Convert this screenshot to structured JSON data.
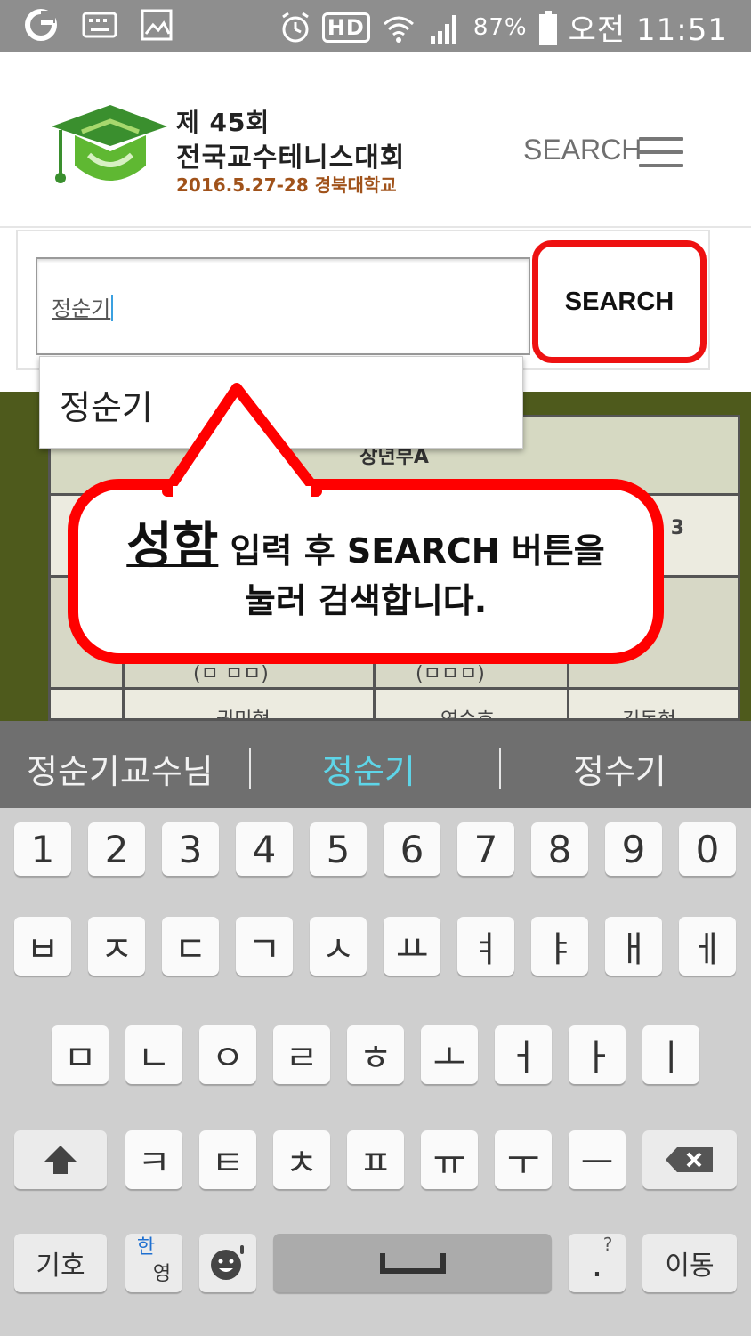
{
  "status_bar": {
    "battery_percent": "87%",
    "time": "오전 11:51",
    "network_label": "HD"
  },
  "header": {
    "logo_line1": "제 45회",
    "logo_line2": "전국교수테니스대회",
    "logo_date": "2016.5.27-28 경북대학교",
    "search_link": "SEARCH"
  },
  "search": {
    "input_value": "정순기",
    "button_label": "SEARCH"
  },
  "autocomplete": {
    "items": [
      "정순기"
    ]
  },
  "table": {
    "header": "장년부A",
    "row2_col3": "3",
    "row3_col1": "(ㅁ ㅁㅁ)",
    "row3_col2": "(ㅁㅁㅁ)",
    "row4": [
      "권민혁",
      "염승호",
      "김동현"
    ]
  },
  "callout": {
    "big_word": "성함",
    "line1_rest": " 입력 후 SEARCH 버튼을",
    "line2": "눌러 검색합니다."
  },
  "keyboard": {
    "suggestions": [
      "정순기교수님",
      "정순기",
      "정수기"
    ],
    "active_suggestion_index": 1,
    "row_numbers": [
      "1",
      "2",
      "3",
      "4",
      "5",
      "6",
      "7",
      "8",
      "9",
      "0"
    ],
    "row1": [
      "ㅂ",
      "ㅈ",
      "ㄷ",
      "ㄱ",
      "ㅅ",
      "ㅛ",
      "ㅕ",
      "ㅑ",
      "ㅐ",
      "ㅔ"
    ],
    "row2": [
      "ㅁ",
      "ㄴ",
      "ㅇ",
      "ㄹ",
      "ㅎ",
      "ㅗ",
      "ㅓ",
      "ㅏ",
      "ㅣ"
    ],
    "row3": [
      "ㅋ",
      "ㅌ",
      "ㅊ",
      "ㅍ",
      "ㅠ",
      "ㅜ",
      "ㅡ"
    ],
    "symbols_label": "기호",
    "lang_label_top": "한",
    "lang_label_bottom": "영",
    "move_label": "이동",
    "punct_label": "?",
    "punct_main": "."
  },
  "colors": {
    "highlight_red": "#ee1111",
    "suggestion_active": "#5ed5e8",
    "page_olive": "#4e5a1c"
  },
  "icons": [
    "sync-icon",
    "keyboard-icon",
    "image-icon",
    "alarm-icon",
    "wifi-icon",
    "signal-icon",
    "battery-icon",
    "hamburger-menu-icon",
    "shift-icon",
    "backspace-icon",
    "emoji-icon",
    "space-icon"
  ]
}
